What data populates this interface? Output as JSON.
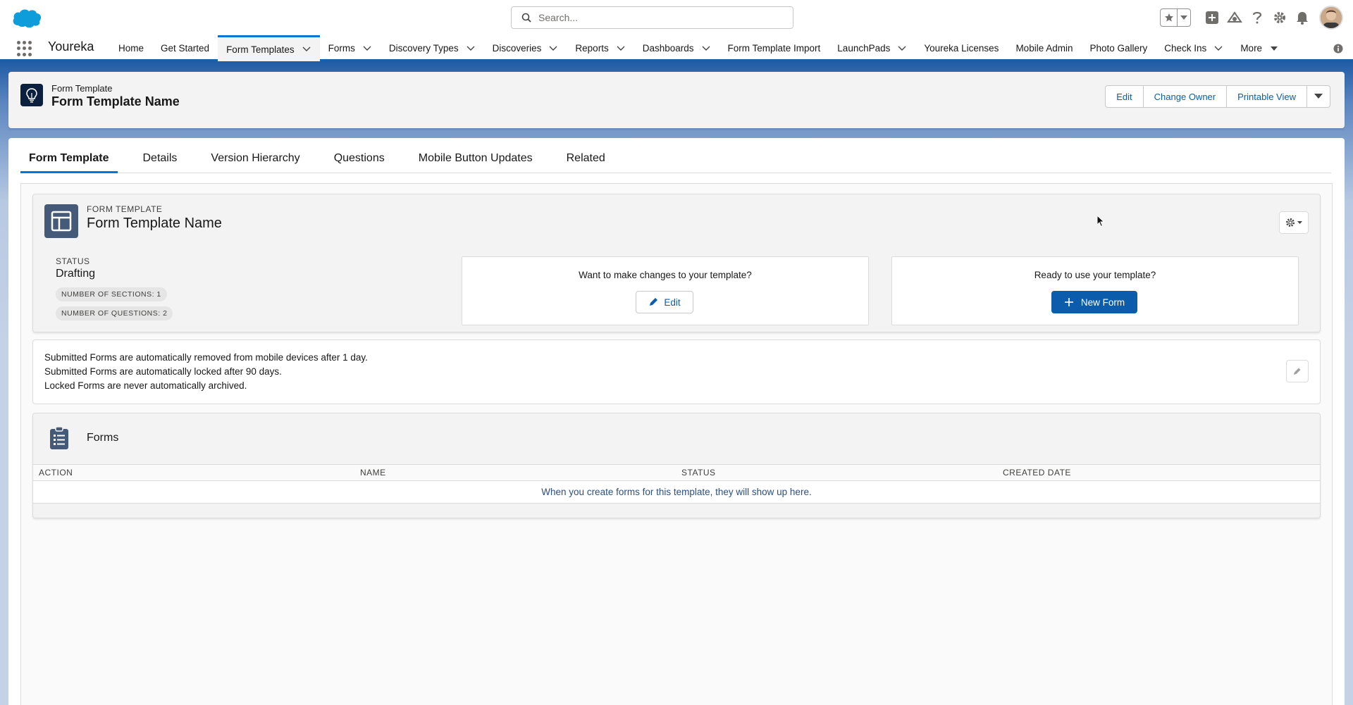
{
  "header": {
    "search_placeholder": "Search..."
  },
  "nav": {
    "app_name": "Youreka",
    "items": [
      {
        "label": "Home",
        "dropdown": false,
        "active": false
      },
      {
        "label": "Get Started",
        "dropdown": false,
        "active": false
      },
      {
        "label": "Form Templates",
        "dropdown": true,
        "active": true
      },
      {
        "label": "Forms",
        "dropdown": true,
        "active": false
      },
      {
        "label": "Discovery Types",
        "dropdown": true,
        "active": false
      },
      {
        "label": "Discoveries",
        "dropdown": true,
        "active": false
      },
      {
        "label": "Reports",
        "dropdown": true,
        "active": false
      },
      {
        "label": "Dashboards",
        "dropdown": true,
        "active": false
      },
      {
        "label": "Form Template Import",
        "dropdown": false,
        "active": false
      },
      {
        "label": "LaunchPads",
        "dropdown": true,
        "active": false
      },
      {
        "label": "Youreka Licenses",
        "dropdown": false,
        "active": false
      },
      {
        "label": "Mobile Admin",
        "dropdown": false,
        "active": false
      },
      {
        "label": "Photo Gallery",
        "dropdown": false,
        "active": false
      },
      {
        "label": "Check Ins",
        "dropdown": true,
        "active": false
      },
      {
        "label": "More",
        "dropdown": true,
        "active": false
      }
    ]
  },
  "highlights": {
    "object_label": "Form Template",
    "record_name": "Form Template Name",
    "buttons": [
      "Edit",
      "Change Owner",
      "Printable View"
    ]
  },
  "tabs": [
    "Form Template",
    "Details",
    "Version Hierarchy",
    "Questions",
    "Mobile Button Updates",
    "Related"
  ],
  "template_card": {
    "label": "FORM TEMPLATE",
    "name": "Form Template Name",
    "status_label": "STATUS",
    "status_value": "Drafting",
    "sections_pill": "NUMBER OF SECTIONS: 1",
    "questions_pill": "NUMBER OF QUESTIONS: 2",
    "change_prompt": "Want to make changes to your template?",
    "edit_label": "Edit",
    "use_prompt": "Ready to use your template?",
    "new_form_label": "New Form"
  },
  "notice": {
    "lines": [
      "Submitted Forms are automatically removed from mobile devices after 1 day.",
      "Submitted Forms are automatically locked after 90 days.",
      "Locked Forms are never automatically archived."
    ]
  },
  "forms": {
    "title": "Forms",
    "columns": [
      "ACTION",
      "NAME",
      "STATUS",
      "CREATED DATE"
    ],
    "empty_message": "When you create forms for this template, they will show up here."
  },
  "colors": {
    "brand_blue": "#0176d3",
    "button_blue": "#0b5cab",
    "header_band": "#1f5ca5"
  }
}
